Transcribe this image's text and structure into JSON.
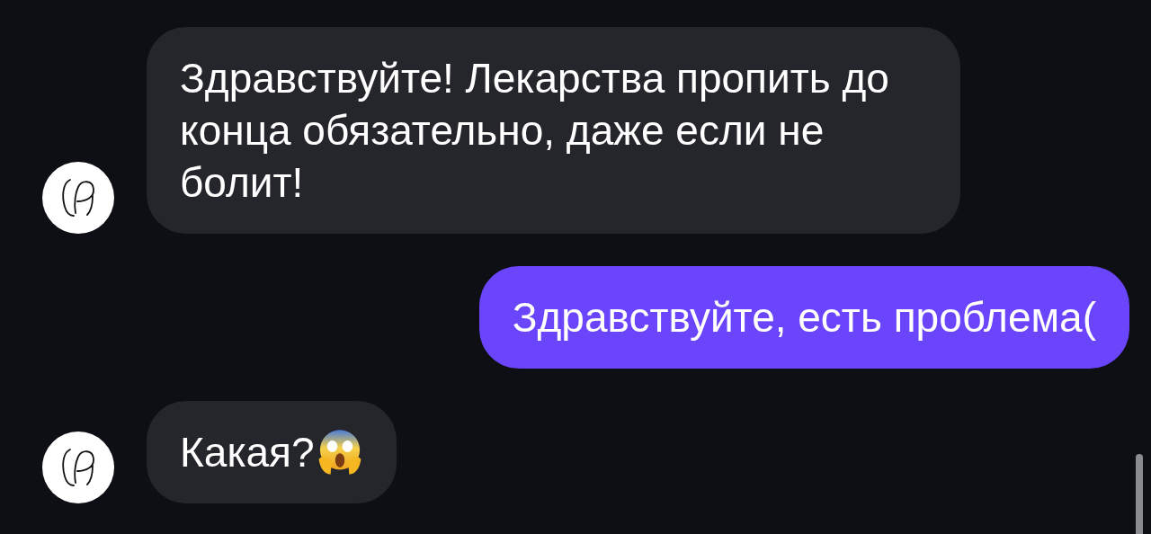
{
  "messages": [
    {
      "kind": "incoming",
      "text": "Здравствуйте! Лекарства пропить до конца обязательно, даже если не болит!",
      "emoji_after": false
    },
    {
      "kind": "outgoing",
      "text": "Здравствуйте, есть проблема(",
      "emoji_after": false
    },
    {
      "kind": "incoming",
      "text": "Какая?",
      "emoji_after": true
    }
  ]
}
